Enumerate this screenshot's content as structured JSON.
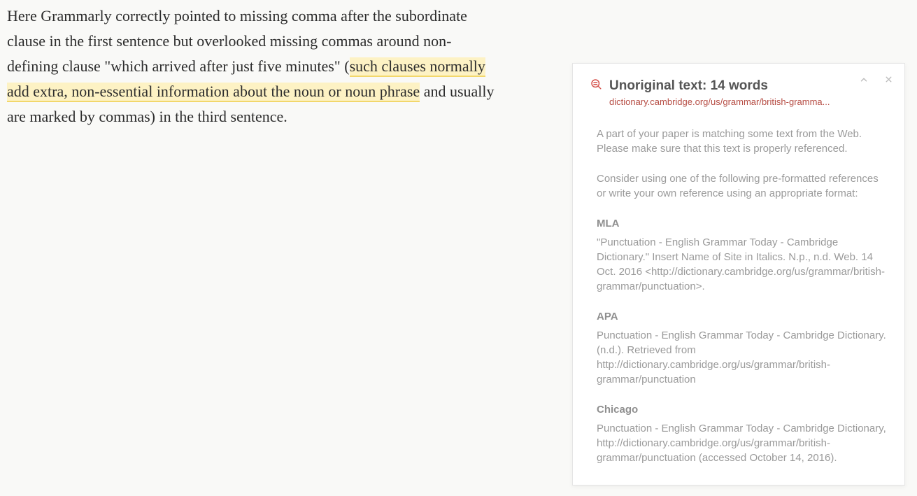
{
  "document": {
    "segments": [
      {
        "text": "Here Grammarly correctly pointed to missing comma after the subordinate clause in the first sentence but overlooked missing commas around non-defining clause \"which arrived after just five minutes\" (",
        "hl": false
      },
      {
        "text": "such clauses normally add extra, non-essential information about the noun or noun phrase",
        "hl": true
      },
      {
        "text": " and usually are marked by commas) in the third sentence.",
        "hl": false
      }
    ]
  },
  "panel": {
    "title": "Unoriginal text: 14 words",
    "source": "dictionary.cambridge.org/us/grammar/british-gramma...",
    "note1": "A part of your paper is matching some text from the Web. Please make sure that this text is properly referenced.",
    "note2": "Consider using one of the following pre-formatted references or write your own reference using an appropriate format:",
    "references": [
      {
        "label": "MLA",
        "text": "\"Punctuation - English Grammar Today - Cambridge Dictionary.\" Insert Name of Site in Italics. N.p., n.d. Web. 14 Oct. 2016 <http://dictionary.cambridge.org/us/grammar/british-grammar/punctuation>."
      },
      {
        "label": "APA",
        "text": "Punctuation - English Grammar Today - Cambridge Dictionary. (n.d.). Retrieved from http://dictionary.cambridge.org/us/grammar/british-grammar/punctuation"
      },
      {
        "label": "Chicago",
        "text": "Punctuation - English Grammar Today - Cambridge Dictionary, http://dictionary.cambridge.org/us/grammar/british-grammar/punctuation (accessed October 14, 2016)."
      }
    ]
  }
}
